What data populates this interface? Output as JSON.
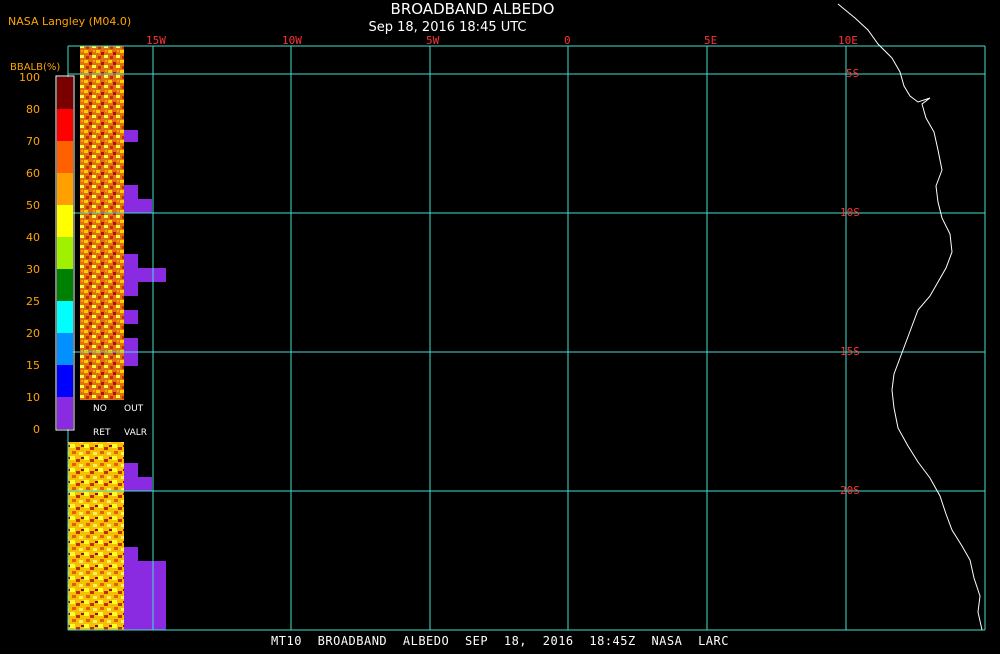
{
  "header": {
    "credit": "NASA Langley (M04.0)",
    "title": "BROADBAND ALBEDO",
    "subtitle": "Sep 18, 2016 18:45 UTC"
  },
  "footer": {
    "caption": "MT10 BROADBAND ALBEDO SEP 18, 2016 18:45Z NASA LARC"
  },
  "legend": {
    "title": "BBALB(%)",
    "labels": [
      "100",
      "80",
      "70",
      "60",
      "50",
      "40",
      "30",
      "25",
      "20",
      "15",
      "10",
      "0"
    ],
    "colors": [
      "#7a0000",
      "#ff0000",
      "#ff6000",
      "#ffa000",
      "#ffff00",
      "#a0f000",
      "#008000",
      "#00ffff",
      "#0090ff",
      "#0000ff",
      "#8a2be2"
    ],
    "foot_left_1": "NO",
    "foot_right_1": "OUT",
    "foot_left_2": "RET",
    "foot_right_2": "VALR"
  },
  "map": {
    "longitude_labels": [
      "15W",
      "10W",
      "5W",
      "0",
      "5E",
      "10E"
    ],
    "latitude_labels": [
      "5S",
      "10S",
      "15S",
      "20S"
    ],
    "grid_color": "#40e0d0",
    "coast_color": "#ffffff",
    "label_color": "#ff3333"
  }
}
